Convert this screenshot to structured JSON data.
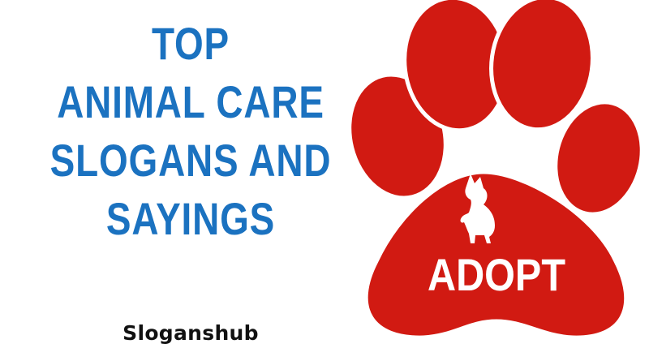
{
  "headline": {
    "lines": [
      "TOP",
      "ANIMAL CARE",
      "SLOGANS AND",
      "SAYINGS"
    ],
    "color": "#1b72c0"
  },
  "brand": {
    "name": "Sloganshub",
    "color": "#111111"
  },
  "paw": {
    "icon": "paw-print-icon",
    "dog_icon": "dog-silhouette-icon",
    "label": "ADOPT",
    "fill_color": "#d11a12",
    "outline_color": "#ffffff",
    "label_color": "#ffffff"
  }
}
